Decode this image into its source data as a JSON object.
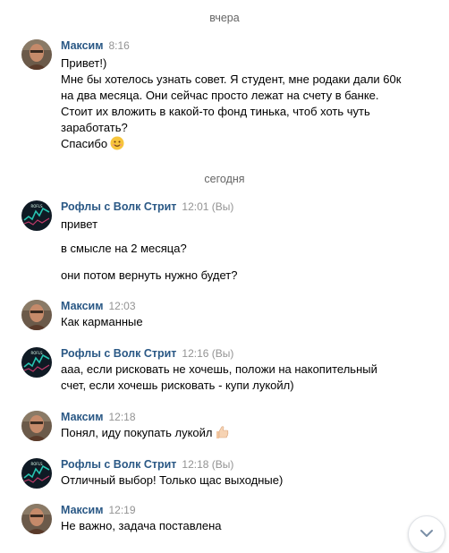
{
  "dividers": {
    "yesterday": "вчера",
    "today": "сегодня"
  },
  "messages": [
    {
      "author": "Максим",
      "time": "8:16",
      "lines": [
        "Привет!)",
        "Мне бы хотелось узнать совет. Я студент, мне родаки дали 60к",
        "на два месяца. Они сейчас просто лежат на счету в банке.",
        "Стоит их вложить в какой-то фонд тинька, чтоб хоть чуть",
        "заработать?",
        "Спасибо"
      ]
    },
    {
      "author": "Рофлы с Волк Стрит",
      "time": "12:01",
      "you": "(Вы)",
      "lines": [
        "привет",
        "в смысле на 2 месяца?",
        "они потом вернуть нужно будет?"
      ]
    },
    {
      "author": "Максим",
      "time": "12:03",
      "lines": [
        "Как карманные"
      ]
    },
    {
      "author": "Рофлы с Волк Стрит",
      "time": "12:16",
      "you": "(Вы)",
      "lines": [
        "ааа, если рисковать не хочешь, положи на накопительный",
        "счет, если хочешь рисковать - купи лукойл)"
      ]
    },
    {
      "author": "Максим",
      "time": "12:18",
      "lines": [
        "Понял, иду покупать лукойл"
      ]
    },
    {
      "author": "Рофлы с Волк Стрит",
      "time": "12:18",
      "you": "(Вы)",
      "lines": [
        "Отличный выбор! Только щас выходные)"
      ]
    },
    {
      "author": "Максим",
      "time": "12:19",
      "lines": [
        "Не важно, задача поставлена"
      ]
    }
  ],
  "icons": {
    "smile": "smile-emoji-icon",
    "thumbs": "thumbs-up-emoji-icon",
    "scroll": "chevron-down-icon"
  },
  "colors": {
    "author": "#2a5885",
    "time": "#939393",
    "divider": "#656565"
  }
}
